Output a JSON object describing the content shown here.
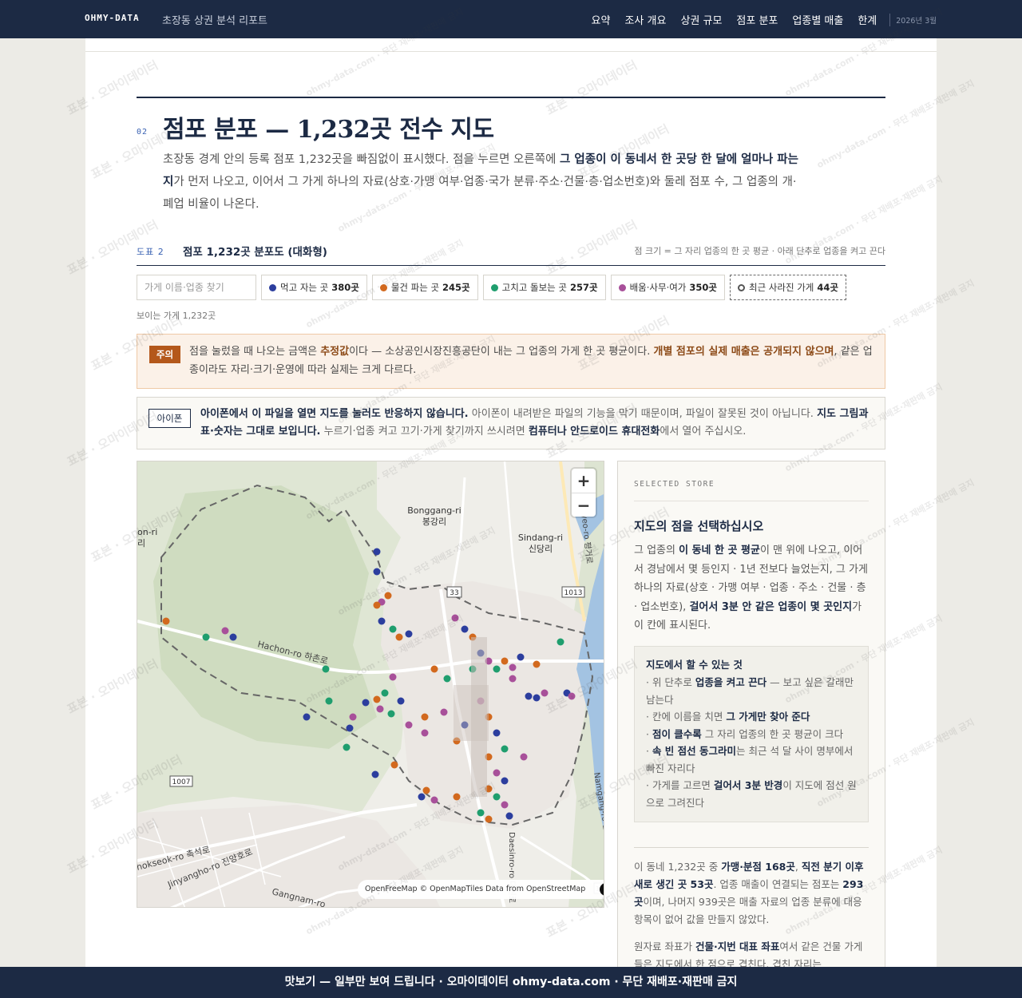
{
  "header": {
    "brand": "OHMY-DATA",
    "subtitle": "초장동 상권 분석 리포트",
    "nav": [
      "요약",
      "조사 개요",
      "상권 규모",
      "점포 분포",
      "업종별 매출",
      "한계"
    ],
    "date": "2026년 3월"
  },
  "section": {
    "number": "02",
    "title": "점포 분포 — 1,232곳 전수 지도",
    "intro_1": "초장동 경계 안의 등록 점포 1,232곳을 빠짐없이 표시했다. 점을 누르면 오른쪽에 ",
    "intro_bold": "그 업종이 이 동네서 한 곳당 한 달에 얼마나 파는지",
    "intro_2": "가 먼저 나오고, 이어서 그 가게 하나의 자료(상호·가맹 여부·업종·국가 분류·주소·건물·층·업소번호)와 둘레 점포 수, 그 업종의 개·폐업 비율이 나온다."
  },
  "figure": {
    "label": "도표 2",
    "title": "점포 1,232곳 분포도 (대화형)",
    "note": "점 크기 = 그 자리 업종의 한 곳 평균 · 아래 단추로 업종을 켜고 끈다"
  },
  "controls": {
    "search_placeholder": "가게 이름·업종 찾기",
    "categories": [
      {
        "label": "먹고 자는 곳",
        "count": "380곳",
        "color": "#2c3e9e"
      },
      {
        "label": "물건 파는 곳",
        "count": "245곳",
        "color": "#d2691e"
      },
      {
        "label": "고치고 돌보는 곳",
        "count": "257곳",
        "color": "#1f9e6e"
      },
      {
        "label": "배움·사무·여가",
        "count": "350곳",
        "color": "#a8509a"
      }
    ],
    "closed_label": "최근 사라진 가게",
    "closed_count": "44곳",
    "visible_count": "보이는 가게 1,232곳"
  },
  "warning": {
    "tag": "주의",
    "t1": "점을 눌렀을 때 나오는 금액은 ",
    "b1": "추정값",
    "t2": "이다 — 소상공인시장진흥공단이 내는 그 업종의 가게 한 곳 평균이다. ",
    "b2": "개별 점포의 실제 매출은 공개되지 않으며",
    "t3": ", 같은 업종이라도 자리·크기·운영에 따라 실제는 크게 다르다."
  },
  "iphone": {
    "tag": "아이폰",
    "b1": "아이폰에서 이 파일을 열면 지도를 눌러도 반응하지 않습니다.",
    "t1": " 아이폰이 내려받은 파일의 기능을 막기 때문이며, 파일이 잘못된 것이 아닙니다. ",
    "b2": "지도 그림과 표·숫자는 그대로 보입니다.",
    "t2": " 누르기·업종 켜고 끄기·가게 찾기까지 쓰시려면 ",
    "b3": "컴퓨터나 안드로이드 휴대전화",
    "t3": "에서 열어 주십시오."
  },
  "map": {
    "zoom_in": "+",
    "zoom_out": "−",
    "attribution": "OpenFreeMap © OpenMapTiles Data from OpenStreetMap",
    "info_icon": "i",
    "places": {
      "bonggang_en": "Bonggang-ri",
      "bonggang_ko": "봉강리",
      "sindang_en": "Sindang-ri",
      "sindang_ko": "신당리",
      "hachon": "Hachon-ro 하촌로",
      "left_en": "on-ri",
      "left_ko": "리",
      "route33": "33",
      "route1013": "1013",
      "route1007": "1007",
      "route10": "10",
      "chokseok": "hokseok-ro 촉석로",
      "jinyangho": "Jinyangho-ro 진양호로",
      "gangnam": "Gangnam-ro",
      "daesinro": "Daesinro-ro 대신로",
      "namgang": "Namgang-ro 남강로",
      "pyeongro": "Pyeo-ro 평거로"
    }
  },
  "panel": {
    "kicker": "SELECTED STORE",
    "title": "지도의 점을 선택하십시오",
    "d1": "그 업종의 ",
    "d1b": "이 동네 한 곳 평균",
    "d2": "이 맨 위에 나오고, 이어서 경남에서 몇 등인지 · 1년 전보다 늘었는지, 그 가게 하나의 자료(상호 · 가맹 여부 · 업종 · 주소 · 건물 · 층 · 업소번호), ",
    "d2b": "걸어서 3분 안 같은 업종이 몇 곳인지",
    "d3": "가 이 칸에 표시된다.",
    "howto_title": "지도에서 할 수 있는 것",
    "h1a": "· 위 단추로 ",
    "h1b": "업종을 켜고 끈다",
    "h1c": " — 보고 싶은 갈래만 남는다",
    "h2a": "· 칸에 이름을 치면 ",
    "h2b": "그 가게만 찾아 준다",
    "h3a": "· ",
    "h3b": "점이 클수록",
    "h3c": " 그 자리 업종의 한 곳 평균이 크다",
    "h4a": "· ",
    "h4b": "속 빈 점선 동그라미",
    "h4c": "는 최근 석 달 사이 명부에서 빠진 자리다",
    "h5a": "· 가게를 고르면 ",
    "h5b": "걸어서 3분 반경",
    "h5c": "이 지도에 점선 원으로 그려진다",
    "s1": "이 동네 1,232곳 중 ",
    "s1b": "가맹·분점 168곳",
    "s2": ", ",
    "s2b": "직전 분기 이후 새로 생긴 곳 53곳",
    "s3": ". 업종 매출이 연결되는 점포는 ",
    "s3b": "293곳",
    "s4": "이며, 나머지 939곳은 매출 자료의 업종 분류에 대응 항목이 없어 값을 만들지 않았다.",
    "n1": "원자료 좌표가 ",
    "n1b": "건물·지번 대표 좌표",
    "n2": "여서 같은 건물 가게들은 지도에서 한 점으로 겹친다. 겹친 자리는"
  },
  "footer": {
    "text": "맛보기 — 일부만 보여 드립니다 · 오마이데이터 ohmy-data.com · 무단 재배포·재판매 금지"
  },
  "watermark": {
    "a": "표본 · 오마이데이터",
    "b": "ohmy-data.com · 무단 재배포·재판매 금지"
  }
}
